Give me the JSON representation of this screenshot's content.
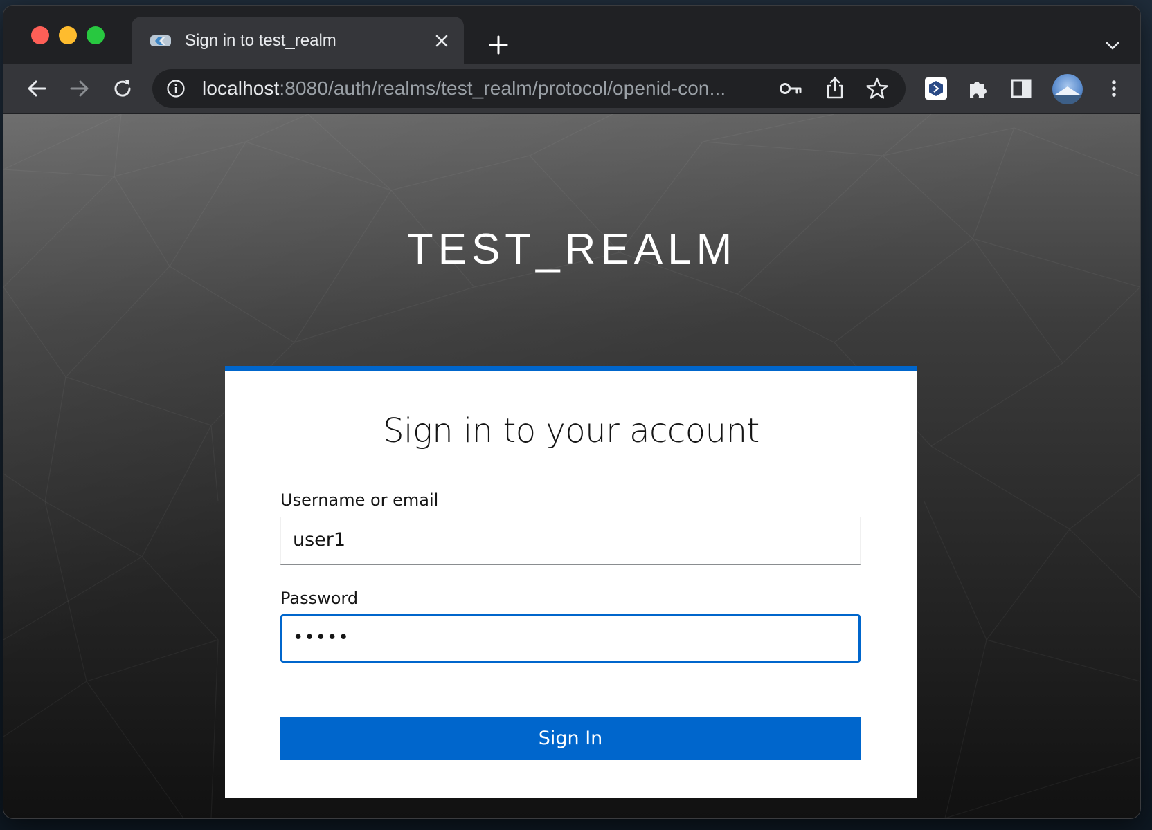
{
  "browser": {
    "tab_title": "Sign in to test_realm",
    "url_host": "localhost",
    "url_rest": ":8080/auth/realms/test_realm/protocol/openid-con...",
    "icons": [
      "back-arrow-icon",
      "forward-arrow-icon",
      "reload-icon",
      "site-info-icon",
      "key-icon",
      "share-icon",
      "star-icon",
      "extension-app-icon",
      "puzzle-extensions-icon",
      "sidebar-icon",
      "profile-avatar",
      "more-vert-icon",
      "new-tab-plus-icon",
      "tab-search-chevron-icon",
      "tab-close-icon"
    ]
  },
  "page": {
    "realm_title": "TEST_REALM",
    "heading": "Sign in to your account",
    "username_label": "Username or email",
    "username_value": "user1",
    "password_label": "Password",
    "password_value": "•••••",
    "sign_in_button": "Sign In"
  },
  "colors": {
    "accent": "#0066cc",
    "browser_dark": "#202124",
    "toolbar": "#35363a"
  }
}
